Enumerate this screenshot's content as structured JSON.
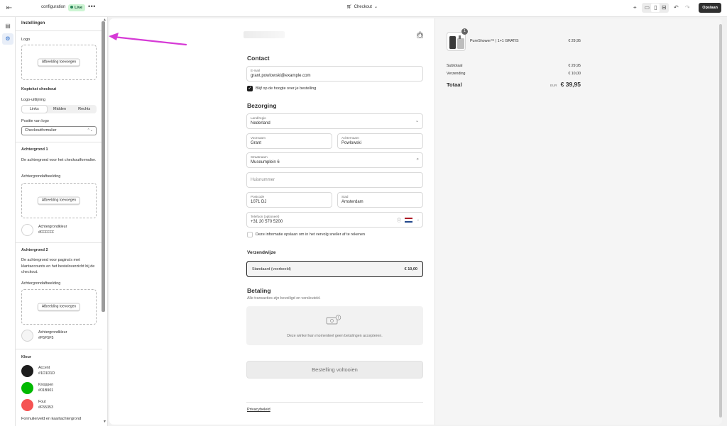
{
  "topbar": {
    "theme_name": "configuration",
    "live_label": "Live",
    "more": "•••",
    "page_select": "Checkout",
    "save_label": "Opslaan"
  },
  "panel": {
    "title": "Instellingen",
    "logo_label": "Logo",
    "add_image": "Afbeelding toevoegen",
    "header_checkout": "Koptekst checkout",
    "logo_alignment": "Logo-uitlijning",
    "align_options": [
      "Links",
      "Midden",
      "Rechts"
    ],
    "align_selected": "Links",
    "logo_position_label": "Positie van logo",
    "logo_position_value": "Checkoutformulier",
    "bg1_title": "Achtergrond 1",
    "bg1_desc": "De achtergrond voor het checkoutformulier.",
    "bg_image_label": "Achtergrondafbeelding",
    "bg_color_label": "Achtergrondkleur",
    "bg1_color": "#FFFFFF",
    "bg2_title": "Achtergrond 2",
    "bg2_desc": "De achtergrond voor pagina's met klantaccounts en het besteloverzicht bij de checkout.",
    "bg2_color": "#F5F5F5",
    "color_title": "Kleur",
    "accent_label": "Accent",
    "accent_color": "#1D1D1D",
    "buttons_label": "Knoppen",
    "buttons_color": "#01B901",
    "error_label": "Fout",
    "error_color": "#F55353",
    "form_field_label": "Formulierveld en kaartachtergrond"
  },
  "checkout": {
    "contact_title": "Contact",
    "email_label": "E-mail",
    "email_value": "grant.powlowski@example.com",
    "newsletter": "Blijf op de hoogte over je bestelling",
    "delivery_title": "Bezorging",
    "country_label": "Land/regio",
    "country_value": "Nederland",
    "firstname_label": "Voornaam",
    "firstname_value": "Grant",
    "lastname_label": "Achternaam",
    "lastname_value": "Powlowski",
    "street_label": "Straatnaam",
    "street_value": "Museumplein 6",
    "housenumber_placeholder": "Huisnummer",
    "postcode_label": "Postcode",
    "postcode_value": "1071 DJ",
    "city_label": "Stad",
    "city_value": "Amsterdam",
    "phone_label": "Telefoon (optioneel)",
    "phone_value": "+31 20 570 5200",
    "save_info": "Deze informatie opslaan om in het vervolg sneller af te rekenen",
    "shipping_title": "Verzendwijze",
    "shipping_option": "Standaard (voorbeeld)",
    "shipping_price": "€ 10,00",
    "payment_title": "Betaling",
    "payment_sub": "Alle transacties zijn beveiligd en versleuteld.",
    "payment_msg": "Deze winkel kan momenteel geen betalingen accepteren.",
    "complete_btn": "Bestelling voltooien",
    "privacy": "Privacybeleid"
  },
  "summary": {
    "qty": "1",
    "product": "PureShower™ | 1+1 GRATIS",
    "product_price": "€ 29,95",
    "subtotal_label": "Subtotaal",
    "subtotal": "€ 29,95",
    "shipping_label": "Verzending",
    "shipping": "€ 10,00",
    "total_label": "Totaal",
    "currency": "EUR",
    "total": "€ 39,95"
  },
  "colors": {
    "annotation_arrow": "#d63ad6",
    "accent": "#1d1d1d"
  }
}
